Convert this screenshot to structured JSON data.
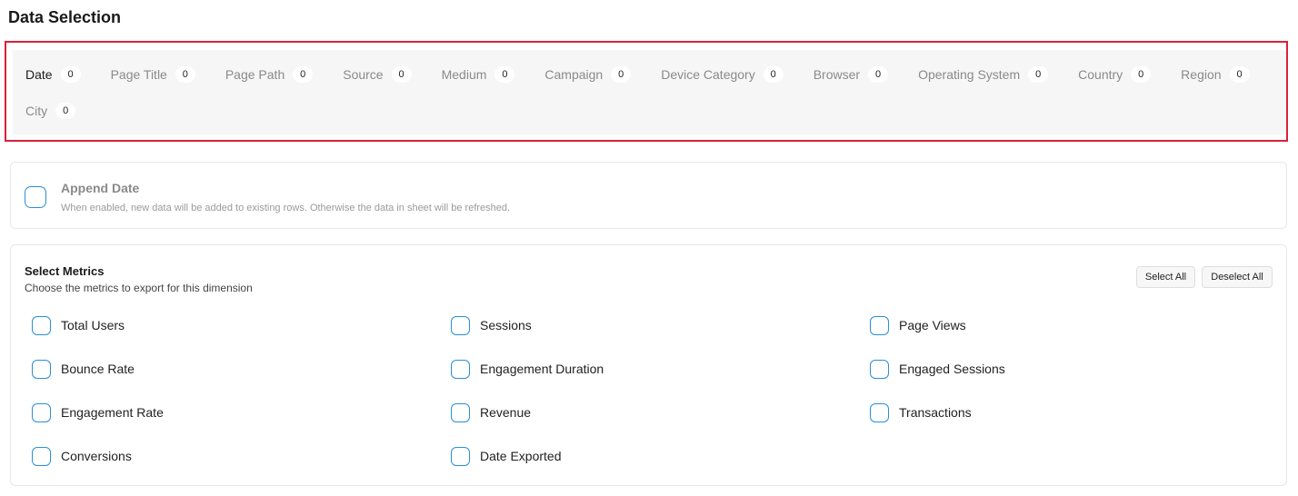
{
  "page": {
    "title": "Data Selection"
  },
  "dimensions": {
    "tabs": [
      {
        "label": "Date",
        "count": "0",
        "active": true
      },
      {
        "label": "Page Title",
        "count": "0"
      },
      {
        "label": "Page Path",
        "count": "0"
      },
      {
        "label": "Source",
        "count": "0"
      },
      {
        "label": "Medium",
        "count": "0"
      },
      {
        "label": "Campaign",
        "count": "0"
      },
      {
        "label": "Device Category",
        "count": "0"
      },
      {
        "label": "Browser",
        "count": "0"
      },
      {
        "label": "Operating System",
        "count": "0"
      },
      {
        "label": "Country",
        "count": "0"
      },
      {
        "label": "Region",
        "count": "0"
      },
      {
        "label": "City",
        "count": "0"
      }
    ],
    "highlight_color": "#d9213a"
  },
  "append": {
    "title": "Append Date",
    "description": "When enabled, new data will be added to existing rows. Otherwise the data in sheet will be refreshed.",
    "checked": false
  },
  "metrics": {
    "title": "Select Metrics",
    "subtitle": "Choose the metrics to export for this dimension",
    "select_all_label": "Select All",
    "deselect_all_label": "Deselect All",
    "items": [
      {
        "label": "Total Users",
        "checked": false
      },
      {
        "label": "Sessions",
        "checked": false
      },
      {
        "label": "Page Views",
        "checked": false
      },
      {
        "label": "Bounce Rate",
        "checked": false
      },
      {
        "label": "Engagement Duration",
        "checked": false
      },
      {
        "label": "Engaged Sessions",
        "checked": false
      },
      {
        "label": "Engagement Rate",
        "checked": false
      },
      {
        "label": "Revenue",
        "checked": false
      },
      {
        "label": "Transactions",
        "checked": false
      },
      {
        "label": "Conversions",
        "checked": false
      },
      {
        "label": "Date Exported",
        "checked": false
      }
    ],
    "accent_color": "#2b8fd6"
  }
}
